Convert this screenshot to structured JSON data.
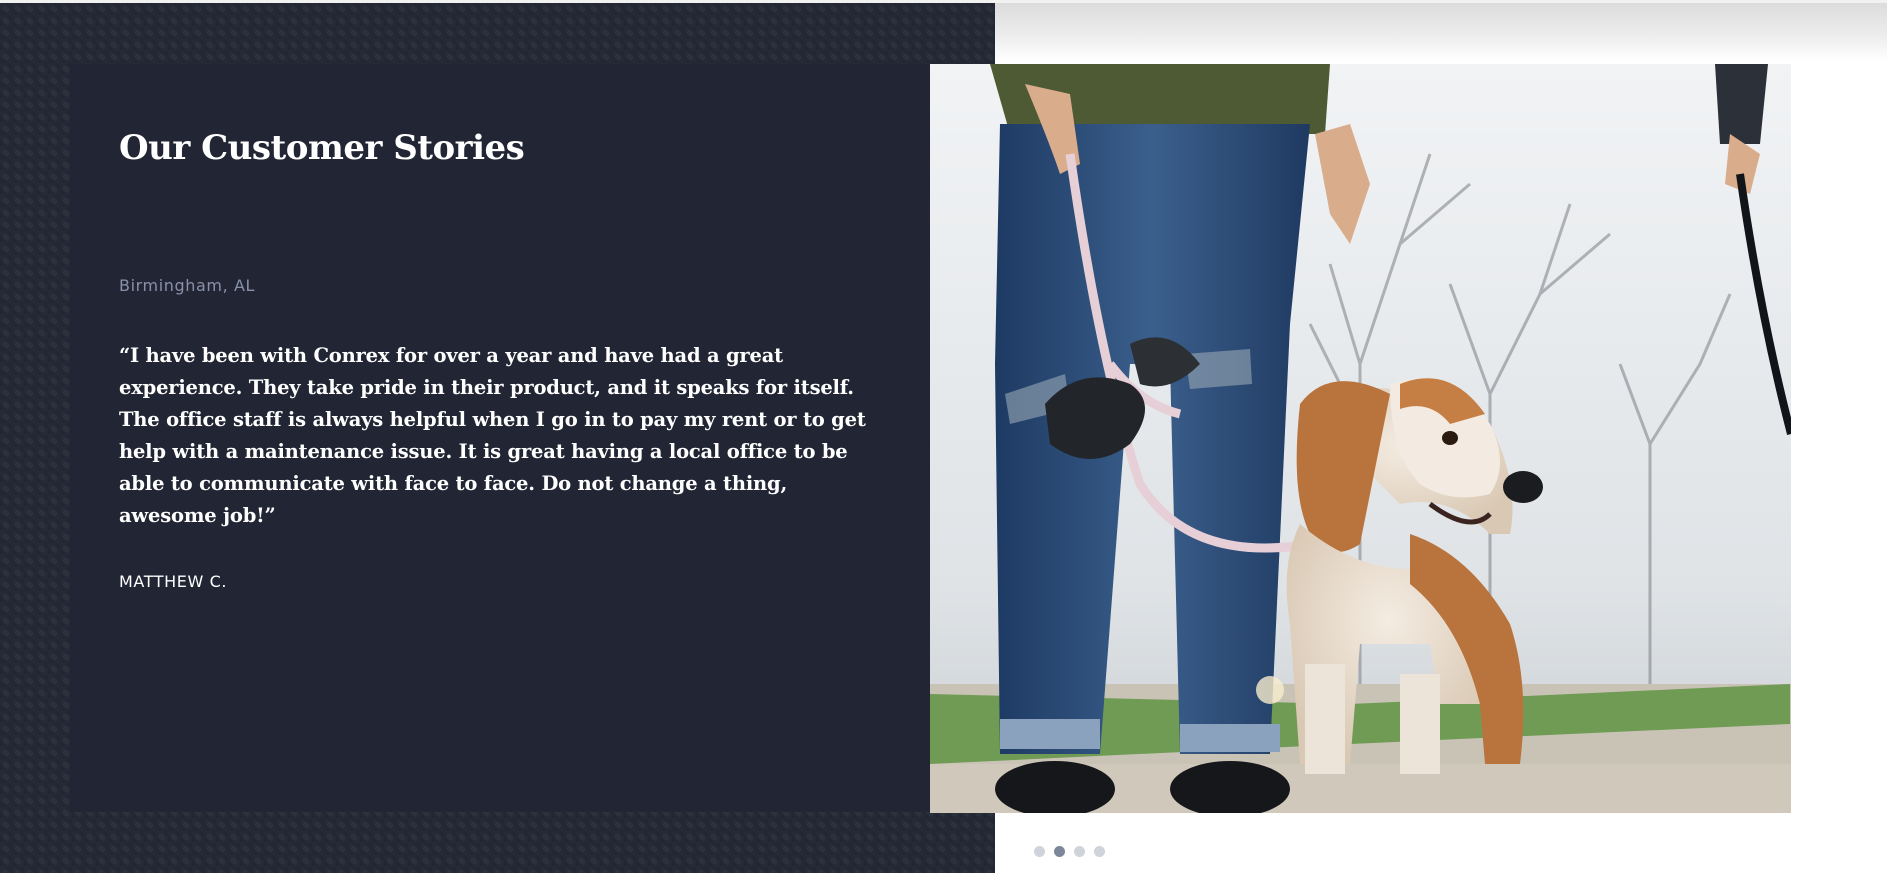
{
  "section": {
    "title": "Our Customer Stories"
  },
  "testimonial": {
    "location": "Birmingham, AL",
    "quote": "“I have been with Conrex for over a year and have had a great experience. They take pride in their product, and it speaks for itself. The office staff is always helpful when I go in to pay my rent or to get help with a maintenance issue. It is great having a local office to be able to communicate with face to face. Do not change a thing, awesome job!”",
    "author": "MATTHEW C."
  },
  "carousel": {
    "slide_count": 4,
    "active_index": 1
  },
  "colors": {
    "dark_background": "#252a37",
    "card_background": "#222634",
    "location_text": "#8891a8",
    "active_dot": "#7e8799",
    "inactive_dot": "#cfd3da"
  }
}
